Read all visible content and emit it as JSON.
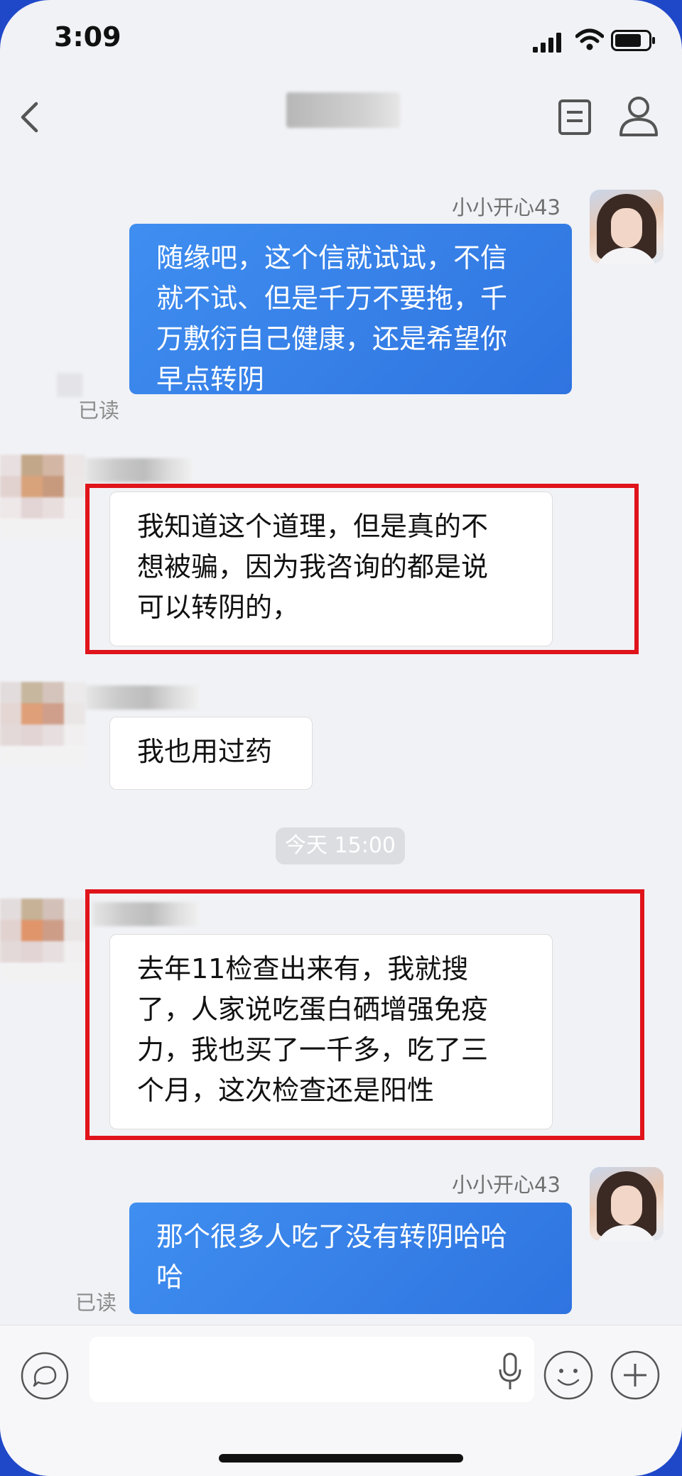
{
  "status_bar": {
    "time": "3:09"
  },
  "nav": {
    "title": ""
  },
  "messages": [
    {
      "sender": "小小开心43",
      "text_lines": [
        "随缘吧，这个信就试试，不信",
        "就不试、但是千万不要拖，千",
        "万敷衍自己健康，还是希望你",
        "早点转阴"
      ],
      "read_label": "已读"
    },
    {
      "text_lines": [
        "我知道这个道理，但是真的不",
        "想被骗，因为我咨询的都是说",
        "可以转阴的，"
      ]
    },
    {
      "text_lines": [
        "我也用过药"
      ]
    },
    {
      "text_lines": [
        "去年11检查出来有，我就搜",
        "了，人家说吃蛋白硒增强免疫",
        "力，我也买了一千多，吃了三",
        "个月，这次检查还是阳性"
      ]
    },
    {
      "sender": "小小开心43",
      "text_lines": [
        "那个很多人吃了没有转阴哈哈",
        "哈"
      ],
      "read_label": "已读"
    }
  ],
  "timestamp": "今天 15:00",
  "colors": {
    "outgoing_bubble": "#2f7fe8",
    "highlight_box": "#e0141b",
    "chat_background": "#f1f2f6"
  },
  "icons": {
    "back": "chevron-left-icon",
    "notes": "notes-icon",
    "profile": "person-icon",
    "chat": "chat-bubble-icon",
    "mic": "microphone-icon",
    "emoji": "smiley-icon",
    "plus": "plus-icon"
  }
}
